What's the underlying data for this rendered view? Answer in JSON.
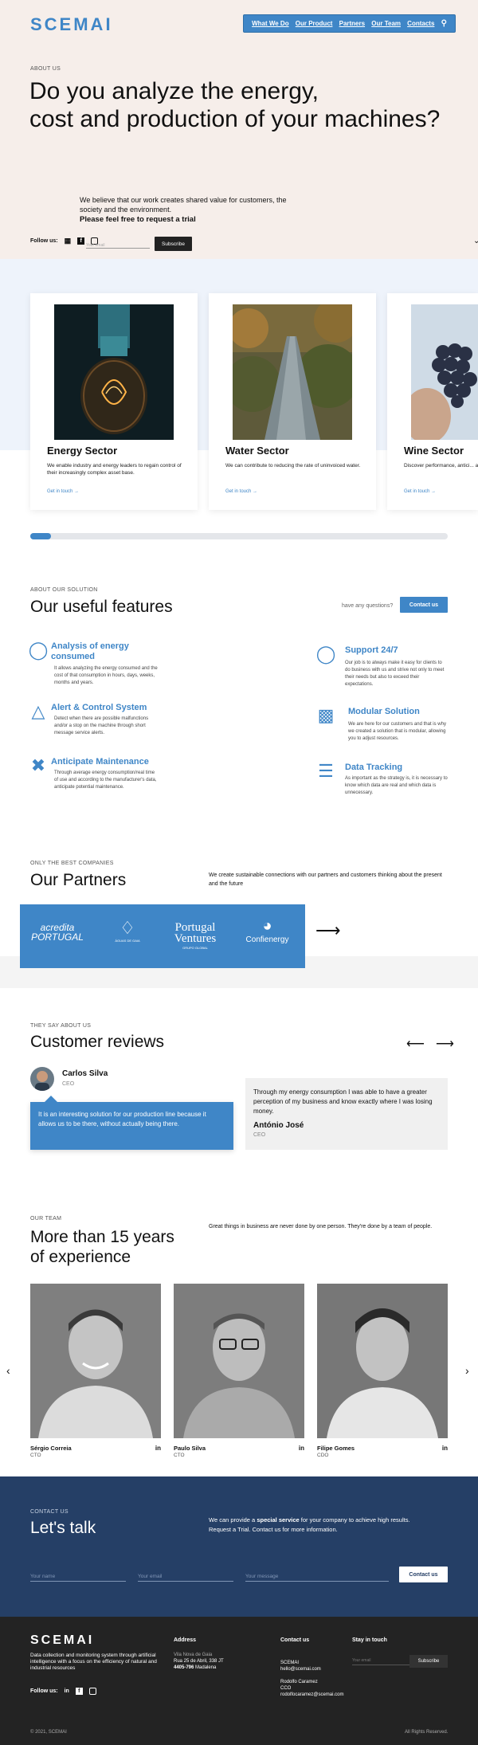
{
  "header": {
    "logo": "SCEMAI",
    "nav": [
      "What We Do",
      "Our Product",
      "Partners",
      "Our Team",
      "Contacts"
    ],
    "search_icon": "search-icon"
  },
  "hero": {
    "label": "ABOUT US",
    "title_line1": "Do you analyze the energy,",
    "title_line2": "cost and production of your machines?",
    "text": "We believe that our work creates shared value for customers, the society and the environment.",
    "cta": "Please feel free to request a trial",
    "follow_label": "Follow us:",
    "email_placeholder": "Your email",
    "subscribe": "Subscribe"
  },
  "sectors": [
    {
      "title": "Energy Sector",
      "text": "We enable industry and energy leaders to regain control of their increasingly complex asset base.",
      "link": "Get in touch →"
    },
    {
      "title": "Water Sector",
      "text": "We can contribute to reducing the rate of uninvoiced water.",
      "link": "Get in touch →"
    },
    {
      "title": "Wine Sector",
      "text": "Discover performance, antici... an unprecedented level of c...",
      "link": "Get in touch →"
    }
  ],
  "features": {
    "label": "ABOUT OUR SOLUTION",
    "title": "Our useful features",
    "have_questions": "have any questions?",
    "contact": "Contact us",
    "items": [
      {
        "title": "Analysis of energy consumed",
        "text": "It allows analyzing the energy consumed and the cost of that consumption in hours, days, weeks, months and years."
      },
      {
        "title": "Alert & Control System",
        "text": "Detect when there are possible malfunctions and/or a stop on the machine through short message service alerts."
      },
      {
        "title": "Anticipate Maintenance",
        "text": "Through average energy consumption/real time of use and according to the manufacturer's data, anticipate potential maintenance."
      },
      {
        "title": "Support 24/7",
        "text": "Our job is to always make it easy for clients to do business with us and strive not only to meet their needs but also to exceed their expectations."
      },
      {
        "title": "Modular Solution",
        "text": "We are here for our customers and that is why we created a solution that is modular, allowing you to adjust resources."
      },
      {
        "title": "Data Tracking",
        "text": "As important as the strategy is, it is necessary to know which data are real and which data is unnecessary."
      }
    ]
  },
  "partners": {
    "label": "ONLY THE BEST COMPANIES",
    "title": "Our Partners",
    "text": "We create sustainable connections with our partners and customers thinking about the present and the future",
    "logos": [
      "acredita PORTUGAL",
      "ÁGUAS DE GAIA",
      "Portugal Ventures",
      "GRUPO GLOBAL",
      "Confienergy"
    ]
  },
  "reviews": {
    "label": "THEY SAY ABOUT US",
    "title": "Customer reviews",
    "items": [
      {
        "name": "Carlos Silva",
        "role": "CEO",
        "text": "It is an interesting solution for our production line because it allows us to be there, without actually being there."
      },
      {
        "name": "António José",
        "role": "CEO",
        "text": "Through my energy consumption I was able to have a greater perception of my business and know exactly where I was losing money."
      }
    ]
  },
  "team": {
    "label": "OUR TEAM",
    "title_line1": "More than 15 years",
    "title_line2": "of experience",
    "text": "Great things in business are never done by one person. They're done by a team of people.",
    "members": [
      {
        "name": "Sérgio Correia",
        "role": "CTO"
      },
      {
        "name": "Paulo Silva",
        "role": "CTO"
      },
      {
        "name": "Filipe Gomes",
        "role": "CDO"
      }
    ],
    "linkedin": "in"
  },
  "talk": {
    "label": "CONTACT US",
    "title": "Let's talk",
    "text_pre": "We can provide a ",
    "text_bold": "special service",
    "text_post": " for your company to achieve high results.",
    "text2": "Request a Trial. Contact us for more information.",
    "name_ph": "Your name",
    "email_ph": "Your email",
    "message_ph": "Your message",
    "button": "Contact us"
  },
  "footer": {
    "logo": "SCEMAI",
    "desc": "Data collection and monitoring system through artificial intelligence with a focus on the efficiency of natural and industrial resources",
    "address_h": "Address",
    "address1": "Vila Nova de Gaia",
    "address2": "Rua 25 de Abril, 338 JT",
    "address3_bold": "4405-796",
    "address3": " Madalena",
    "contact_h": "Contact us",
    "c1": "SCEMAI",
    "c2": "hello@scemai.com",
    "c3": "Rodolfo Caramez",
    "c4": "CCO",
    "c5": "rodolfocaramez@scemai.com",
    "stay_h": "Stay in touch",
    "email_ph": "Your email",
    "subscribe": "Subscribe",
    "follow": "Follow us:",
    "copy": "© 2021, SCEMAI",
    "rights": "All Rights Reserved."
  },
  "colors": {
    "brand": "#3f86c7",
    "dark_navy": "#253f66",
    "footer": "#232323"
  }
}
